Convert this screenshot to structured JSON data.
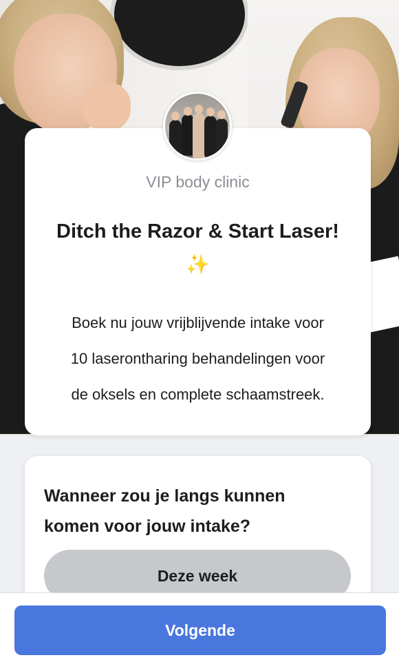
{
  "intro": {
    "clinic_name": "VIP body clinic",
    "headline": "Ditch the Razor & Start Laser!",
    "sparkle": "✨",
    "body_lines": [
      "Boek nu jouw vrijblijvende intake voor",
      "10 laserontharing behandelingen voor",
      "de oksels en complete schaamstreek."
    ]
  },
  "question": {
    "lines": [
      "Wanneer zou je langs kunnen",
      "komen voor jouw intake?"
    ],
    "options": [
      "Deze week"
    ]
  },
  "footer": {
    "next_label": "Volgende"
  },
  "colors": {
    "primary_button": "#4a77de",
    "option_background": "#c6c8cc",
    "page_background": "#eef0f3"
  }
}
